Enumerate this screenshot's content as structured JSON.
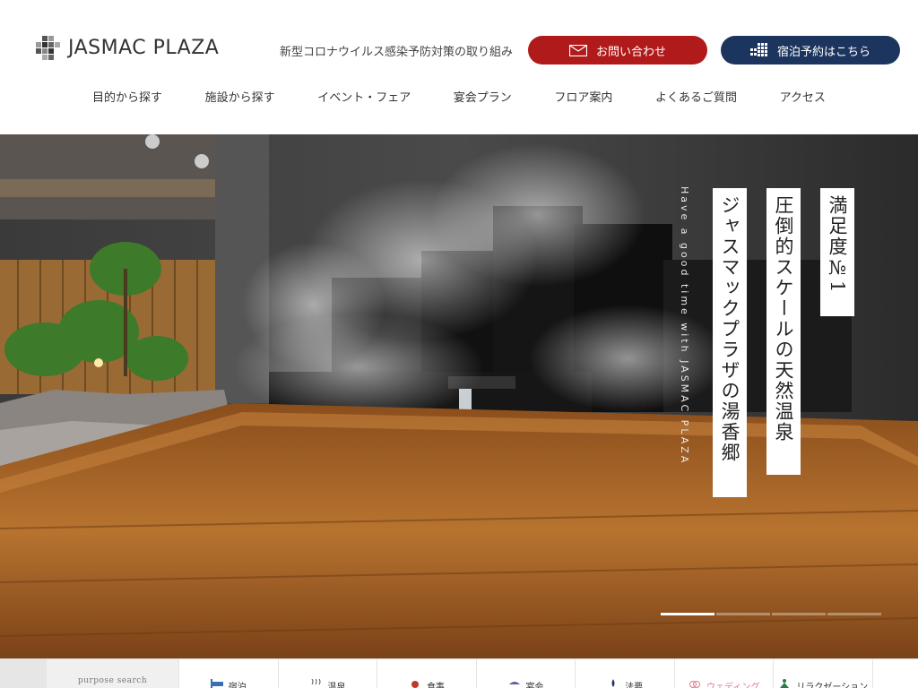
{
  "header": {
    "logo_text": "JASMAC PLAZA",
    "notice": "新型コロナウイルス感染予防対策の取り組み",
    "contact_button": "お問い合わせ",
    "reserve_button": "宿泊予約はこちら",
    "nav": [
      "目的から探す",
      "施設から探す",
      "イベント・フェア",
      "宴会プラン",
      "フロア案内",
      "よくあるご質問",
      "アクセス"
    ]
  },
  "hero": {
    "catch_1": "満足度№1",
    "catch_2": "圧倒的スケールの天然温泉",
    "catch_3": "ジャスマックプラザの湯香郷",
    "tagline": "Have a good time with JASMAC PLAZA",
    "slider": {
      "count": 4,
      "active_index": 0
    }
  },
  "purpose": {
    "label": "purpose search",
    "items": [
      {
        "label": "宿泊",
        "icon": "bed-icon",
        "color": "#3a6fb0"
      },
      {
        "label": "温泉",
        "icon": "hot-spring-icon",
        "color": "#555555"
      },
      {
        "label": "食事",
        "icon": "dining-icon",
        "color": "#c0392b"
      },
      {
        "label": "宴会",
        "icon": "banquet-icon",
        "color": "#6a5a9a"
      },
      {
        "label": "法要",
        "icon": "memorial-icon",
        "color": "#1c355e"
      },
      {
        "label": "ウェディング",
        "icon": "wedding-icon",
        "color": "#e07a8a"
      },
      {
        "label": "リラクゼーション",
        "icon": "relaxation-icon",
        "color": "#2a7a4a"
      }
    ]
  },
  "colors": {
    "contact_button": "#b01a1a",
    "reserve_button": "#1c355e"
  }
}
